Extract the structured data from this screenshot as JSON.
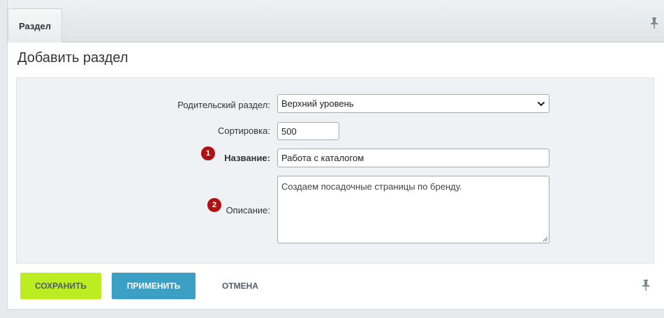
{
  "tabs": [
    {
      "label": "Раздел",
      "active": true
    }
  ],
  "page": {
    "title": "Добавить раздел"
  },
  "form": {
    "parent": {
      "label": "Родительский раздел:",
      "value": "Верхний уровень"
    },
    "sort": {
      "label": "Сортировка:",
      "value": "500"
    },
    "name": {
      "label": "Название:",
      "value": "Работа с каталогом",
      "badge": "1"
    },
    "description": {
      "label": "Описание:",
      "value": "Создаем посадочные страницы по бренду.",
      "badge": "2"
    }
  },
  "buttons": {
    "save": "Сохранить",
    "apply": "Применить",
    "cancel": "Отмена"
  },
  "colors": {
    "save_button": "#bbed21",
    "apply_button": "#3ba0c4",
    "badge": "#b20f12"
  },
  "icons": {
    "pin": "pin-icon"
  }
}
